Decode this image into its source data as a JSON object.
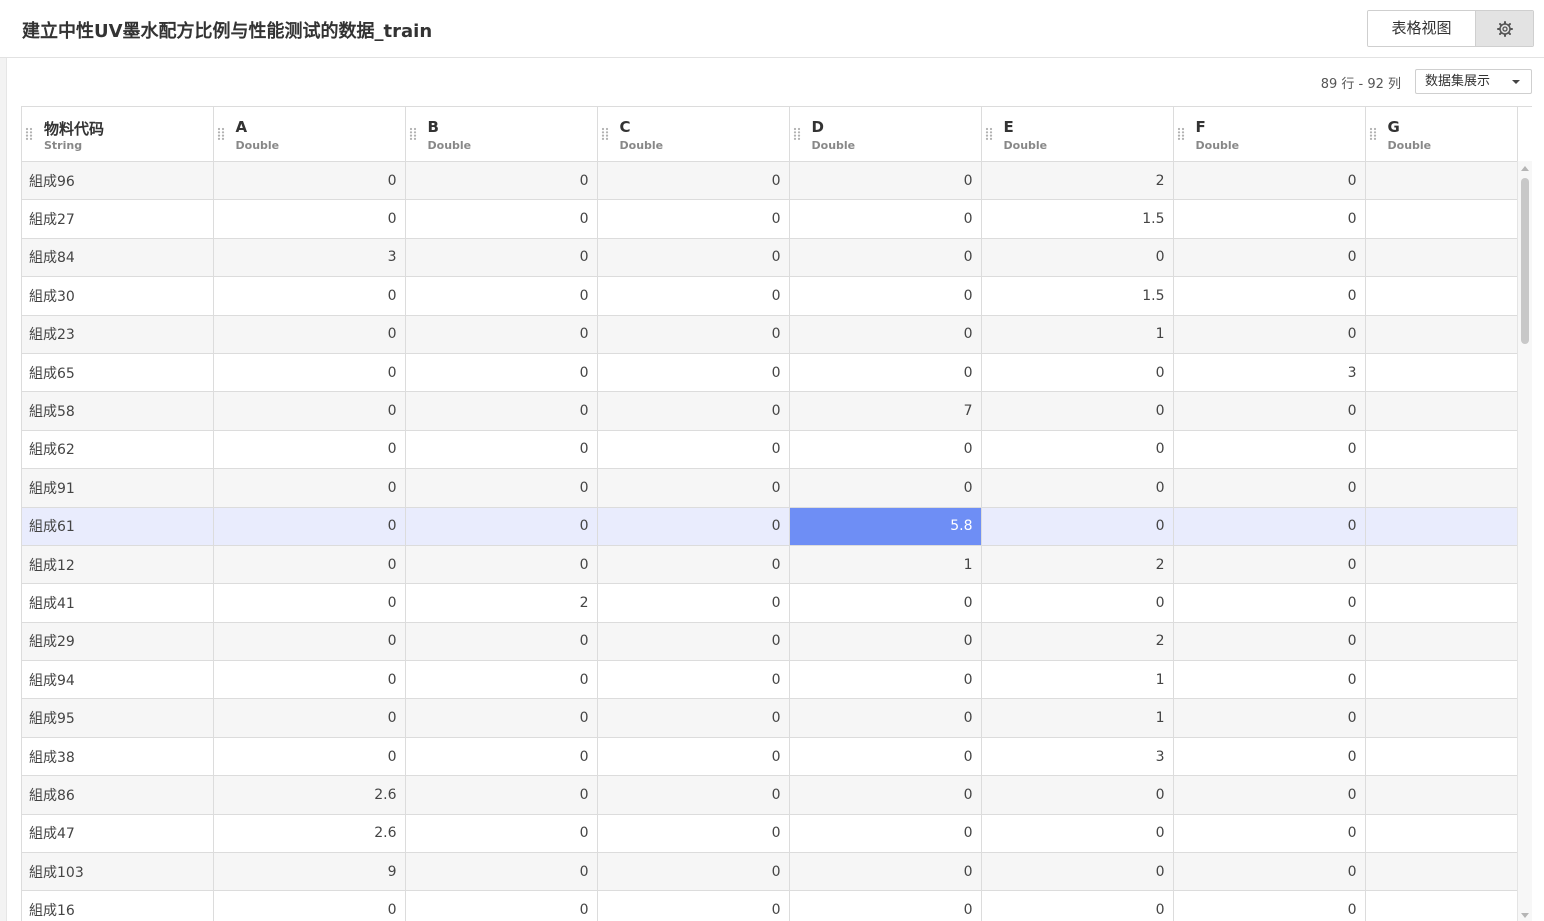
{
  "header": {
    "title": "建立中性UV墨水配方比例与性能测试的数据_train",
    "view_button_label": "表格视图",
    "settings_icon": "gear-icon"
  },
  "toolbar": {
    "row_count": "89 行 - 92 列",
    "dataset_dropdown_label": "数据集展示"
  },
  "columns": [
    {
      "name": "物料代码",
      "type": "String"
    },
    {
      "name": "A",
      "type": "Double"
    },
    {
      "name": "B",
      "type": "Double"
    },
    {
      "name": "C",
      "type": "Double"
    },
    {
      "name": "D",
      "type": "Double"
    },
    {
      "name": "E",
      "type": "Double"
    },
    {
      "name": "F",
      "type": "Double"
    },
    {
      "name": "G",
      "type": "Double"
    }
  ],
  "rows": [
    [
      "組成96",
      "0",
      "0",
      "0",
      "0",
      "2",
      "0",
      ""
    ],
    [
      "組成27",
      "0",
      "0",
      "0",
      "0",
      "1.5",
      "0",
      ""
    ],
    [
      "組成84",
      "3",
      "0",
      "0",
      "0",
      "0",
      "0",
      ""
    ],
    [
      "組成30",
      "0",
      "0",
      "0",
      "0",
      "1.5",
      "0",
      ""
    ],
    [
      "組成23",
      "0",
      "0",
      "0",
      "0",
      "1",
      "0",
      ""
    ],
    [
      "組成65",
      "0",
      "0",
      "0",
      "0",
      "0",
      "3",
      ""
    ],
    [
      "組成58",
      "0",
      "0",
      "0",
      "7",
      "0",
      "0",
      ""
    ],
    [
      "組成62",
      "0",
      "0",
      "0",
      "0",
      "0",
      "0",
      ""
    ],
    [
      "組成91",
      "0",
      "0",
      "0",
      "0",
      "0",
      "0",
      ""
    ],
    [
      "組成61",
      "0",
      "0",
      "0",
      "5.8",
      "0",
      "0",
      ""
    ],
    [
      "組成12",
      "0",
      "0",
      "0",
      "1",
      "2",
      "0",
      ""
    ],
    [
      "組成41",
      "0",
      "2",
      "0",
      "0",
      "0",
      "0",
      ""
    ],
    [
      "組成29",
      "0",
      "0",
      "0",
      "0",
      "2",
      "0",
      ""
    ],
    [
      "組成94",
      "0",
      "0",
      "0",
      "0",
      "1",
      "0",
      ""
    ],
    [
      "組成95",
      "0",
      "0",
      "0",
      "0",
      "1",
      "0",
      ""
    ],
    [
      "組成38",
      "0",
      "0",
      "0",
      "0",
      "3",
      "0",
      ""
    ],
    [
      "組成86",
      "2.6",
      "0",
      "0",
      "0",
      "0",
      "0",
      ""
    ],
    [
      "組成47",
      "2.6",
      "0",
      "0",
      "0",
      "0",
      "0",
      ""
    ],
    [
      "組成103",
      "9",
      "0",
      "0",
      "0",
      "0",
      "0",
      ""
    ],
    [
      "組成16",
      "0",
      "0",
      "0",
      "0",
      "0",
      "0",
      ""
    ]
  ],
  "selection": {
    "row_label": "組成61",
    "column": "D",
    "value": "5.8"
  },
  "colors": {
    "selected_row": "#e9ecfd",
    "active_cell": "#6e8ef5"
  }
}
